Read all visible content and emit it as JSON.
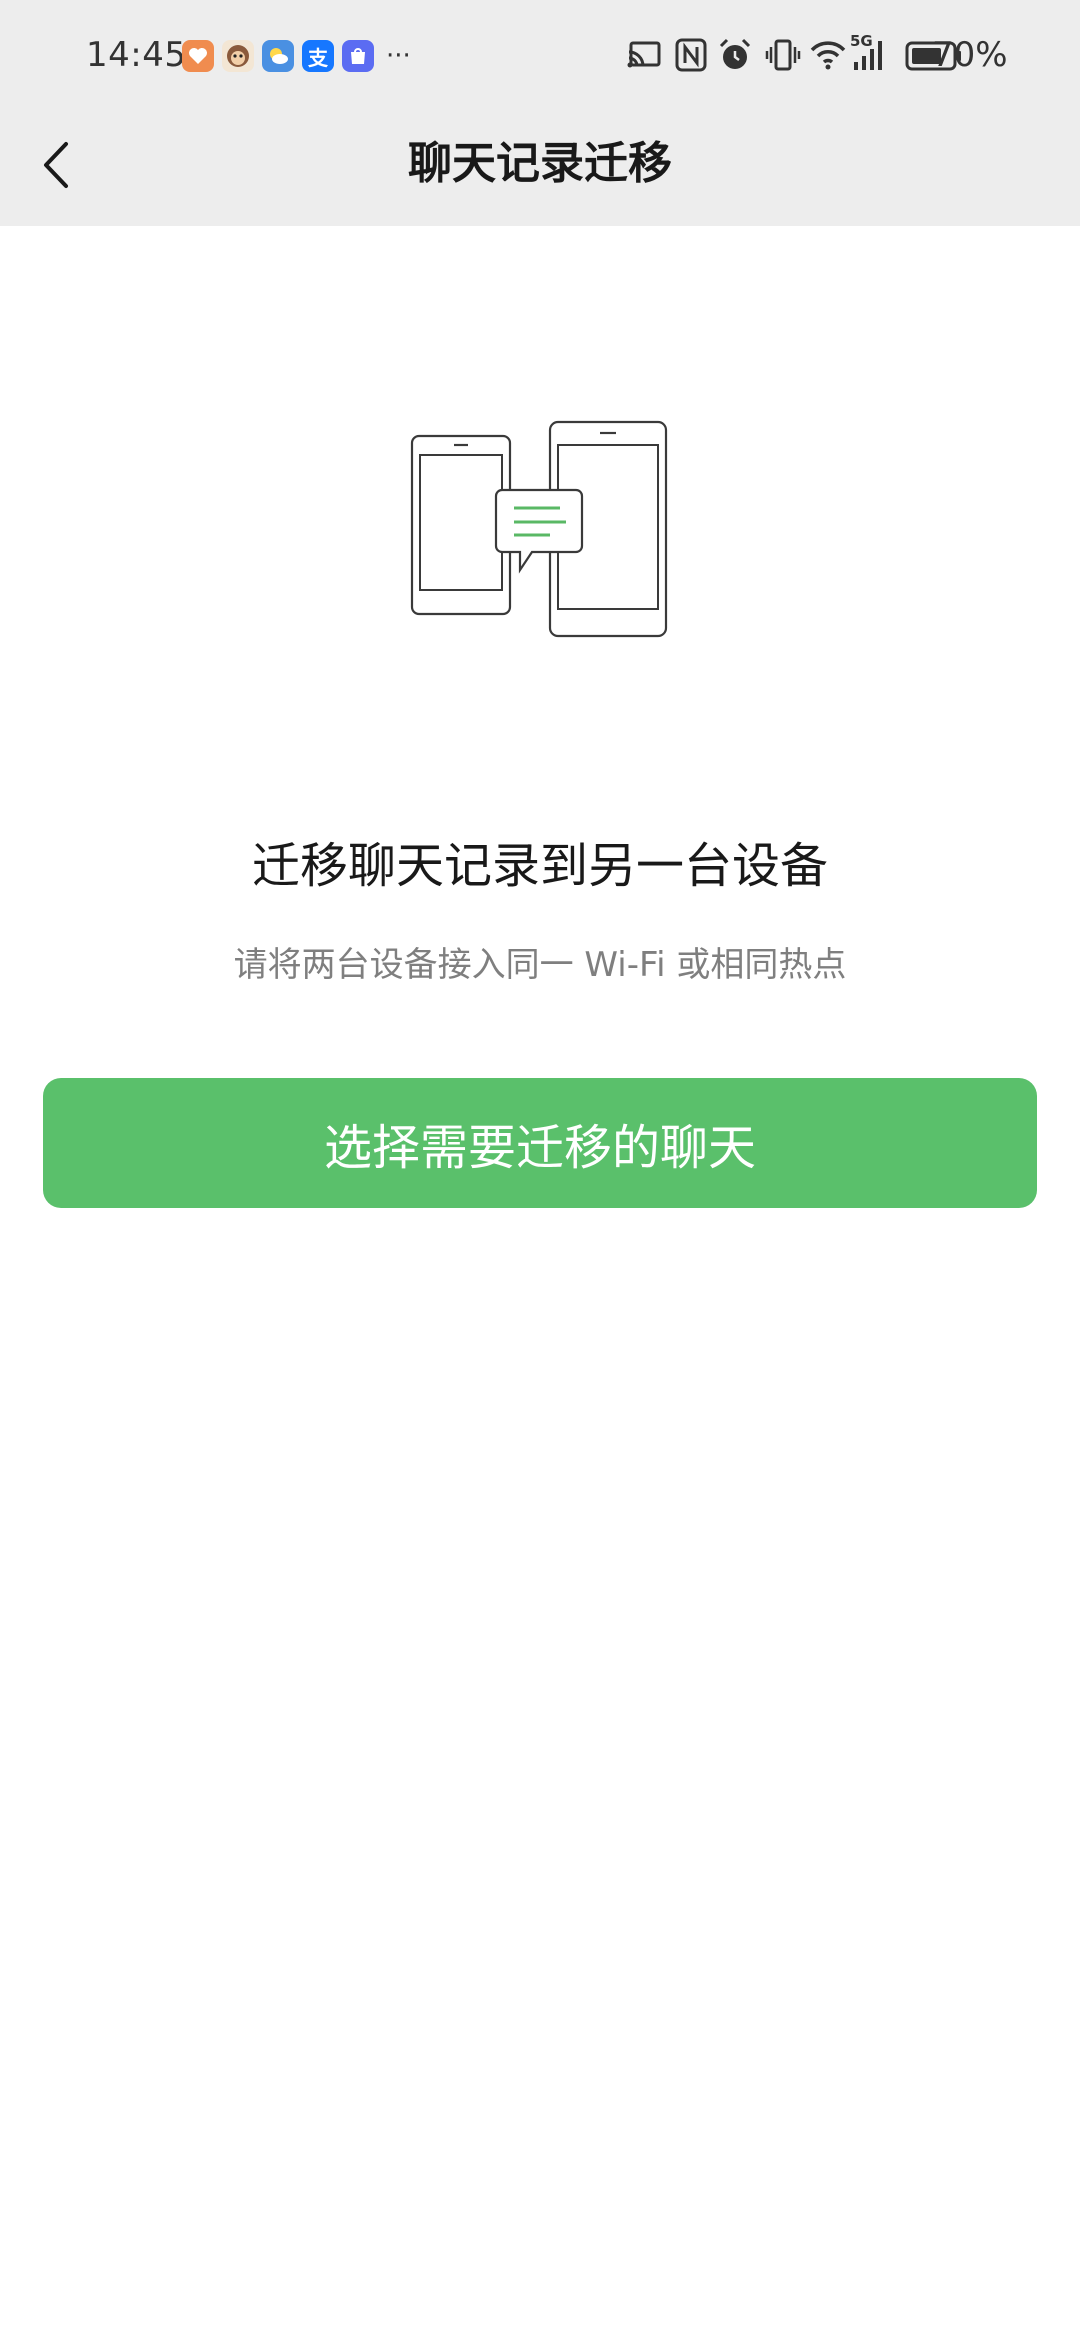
{
  "status_bar": {
    "time": "14:45",
    "battery": "70%",
    "more": "···",
    "network": "5G",
    "notification_icons": [
      "heart-app-icon",
      "monkey-app-icon",
      "weather-app-icon",
      "alipay-icon",
      "shopping-bag-icon"
    ],
    "alipay_glyph": "支",
    "system_icons": [
      "cast-icon",
      "nfc-icon",
      "alarm-icon",
      "vibrate-icon",
      "wifi-icon",
      "signal-icon",
      "battery-icon"
    ]
  },
  "nav": {
    "title": "聊天记录迁移",
    "back_icon": "chevron-left-icon"
  },
  "main": {
    "illustration_icon": "phones-transfer-illustration",
    "heading": "迁移聊天记录到另一台设备",
    "subtext": "请将两台设备接入同一 Wi-Fi 或相同热点",
    "button_label": "选择需要迁移的聊天"
  },
  "colors": {
    "header_bg": "#ededed",
    "accent_green": "#5ac06b",
    "title_text": "#191919",
    "secondary_text": "#7f7f7f"
  }
}
